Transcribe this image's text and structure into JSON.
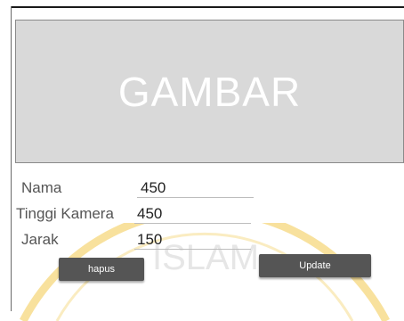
{
  "image": {
    "label": "GAMBAR"
  },
  "fields": [
    {
      "label": "Nama",
      "value": "450"
    },
    {
      "label": "Tinggi Kamera",
      "value": "450"
    },
    {
      "label": "Jarak",
      "value": "150"
    }
  ],
  "buttons": {
    "hapus": "hapus",
    "update": "Update"
  },
  "watermark": {
    "text": "ISLAM"
  },
  "colors": {
    "button": "#555555",
    "image_bg": "#d9d9d9",
    "watermark": "#f2c94c"
  }
}
